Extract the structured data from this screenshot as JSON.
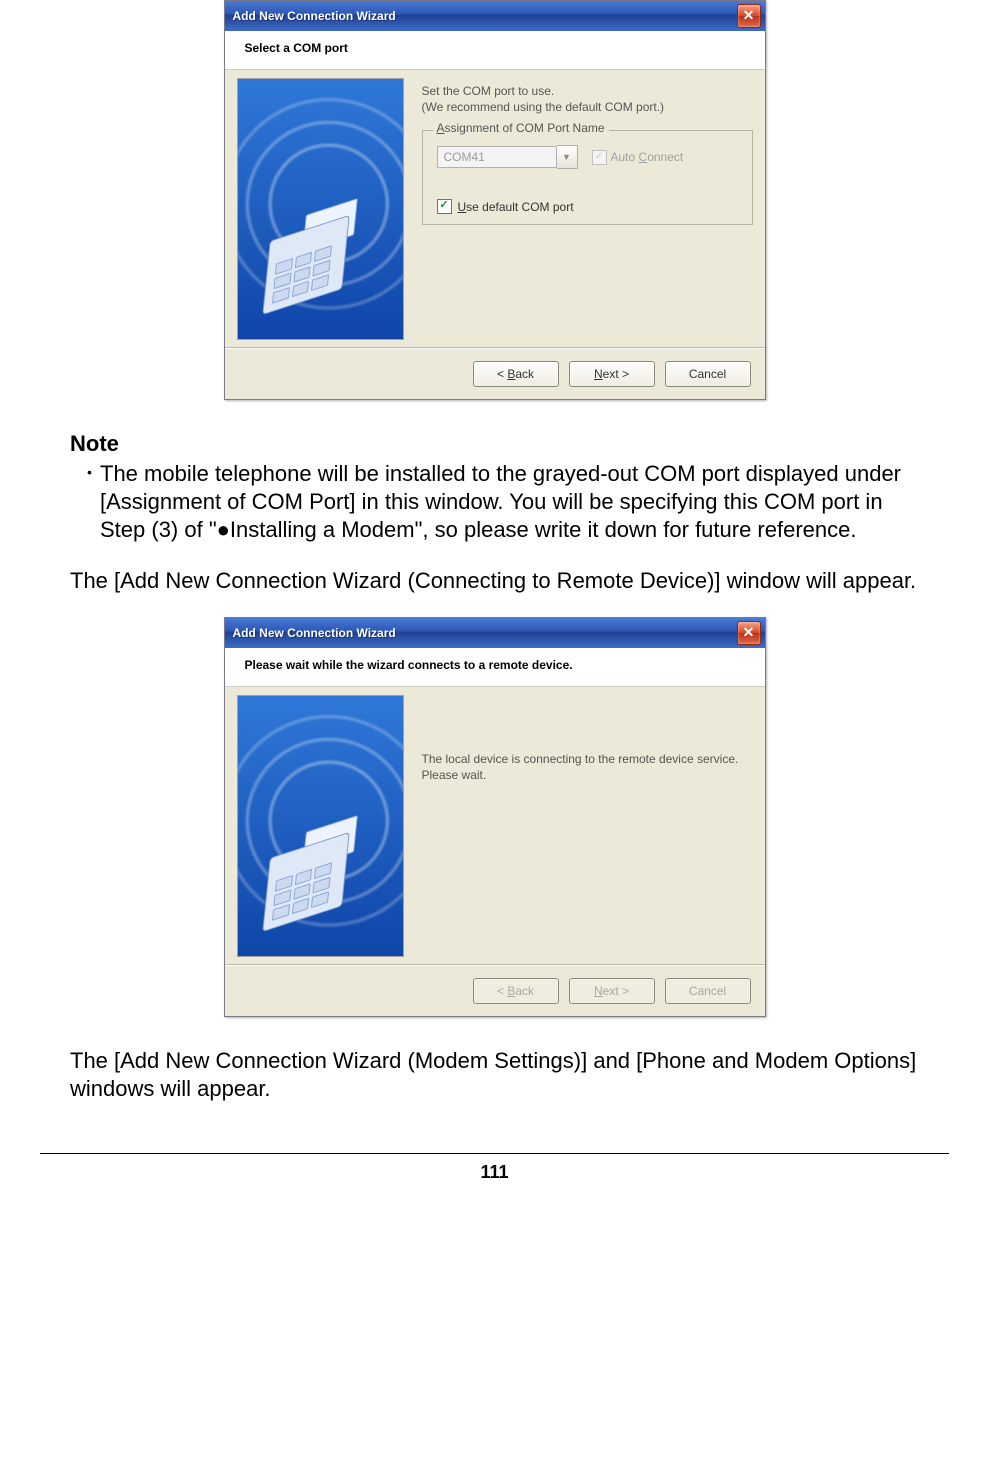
{
  "dialog1": {
    "title": "Add New Connection Wizard",
    "subtitle": "Select a COM port",
    "instr1": "Set the COM port to use.",
    "instr2": "(We recommend using the default COM port.)",
    "group_legend_prefix": "A",
    "group_legend_rest": "ssignment of COM Port Name",
    "com_value": "COM41",
    "auto_connect_prefix": "Auto ",
    "auto_connect_u": "C",
    "auto_connect_rest": "onnect",
    "use_default_u": "U",
    "use_default_rest": "se default COM port",
    "btn_back_pre": "< ",
    "btn_back_u": "B",
    "btn_back_rest": "ack",
    "btn_next_u": "N",
    "btn_next_rest": "ext >",
    "btn_cancel": "Cancel"
  },
  "note": {
    "title": "Note",
    "bullet": "The mobile telephone will be installed to the grayed-out COM port displayed under [Assignment of COM Port] in this window. You will be specifying this COM port in Step (3) of \"●Installing a Modem\", so please write it down for future reference."
  },
  "para1": "The [Add New Connection Wizard (Connecting to Remote Device)] window will appear.",
  "dialog2": {
    "title": "Add New Connection Wizard",
    "subtitle": "Please wait while the wizard connects to a remote device.",
    "msg1": "The local device is connecting to the remote device service.",
    "msg2": "Please wait.",
    "btn_back_pre": "< ",
    "btn_back_u": "B",
    "btn_back_rest": "ack",
    "btn_next_u": "N",
    "btn_next_rest": "ext >",
    "btn_cancel": "Cancel"
  },
  "para2": "The [Add New Connection Wizard (Modem Settings)] and [Phone and Modem Options] windows will appear.",
  "page_number": "111"
}
